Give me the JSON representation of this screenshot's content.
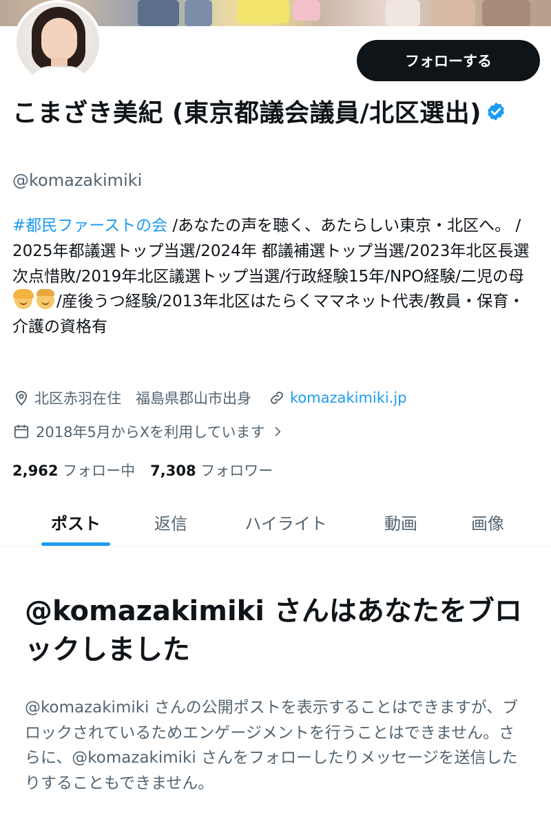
{
  "profile": {
    "display_name": "こまざき美紀 (東京都議会議員/北区選出)",
    "handle": "@komazakimiki",
    "follow_label": "フォローする",
    "bio_hashtag": "#都民ファーストの会",
    "bio_text_1": " /あなたの声を聴く、あたらしい東京・北区へ。 / 2025年都議選トップ当選/2024年 都議補選トップ当選/2023年北区長選 次点惜敗/2019年北区議選トップ当選/行政経験15年/NPO経験/二児の母",
    "bio_text_2": "/産後うつ経験/2013年北区はたらくママネット代表/教員・保育・介護の資格有",
    "location": "北区赤羽在住　福島県郡山市出身",
    "website": "komazakimiki.jp",
    "joined": "2018年5月からXを利用しています",
    "following_count": "2,962",
    "following_label": "フォロー中",
    "followers_count": "7,308",
    "followers_label": "フォロワー"
  },
  "tabs": [
    {
      "label": "ポスト"
    },
    {
      "label": "返信"
    },
    {
      "label": "ハイライト"
    },
    {
      "label": "動画"
    },
    {
      "label": "画像"
    }
  ],
  "blocked": {
    "title": "@komazakimiki さんはあなたをブロックしました",
    "description": "@komazakimiki さんの公開ポストを表示することはできますが、ブロックされているためエンゲージメントを行うことはできません。さらに、@komazakimiki さんをフォローしたりメッセージを送信したりすることもできません。"
  },
  "colors": {
    "accent": "#1d9bf0",
    "text_primary": "#0f1419",
    "text_secondary": "#536471"
  },
  "icons": {
    "verified": "verified-badge-icon",
    "location": "location-pin-icon",
    "link": "link-icon",
    "calendar": "calendar-icon",
    "chevron": "chevron-right-icon"
  }
}
